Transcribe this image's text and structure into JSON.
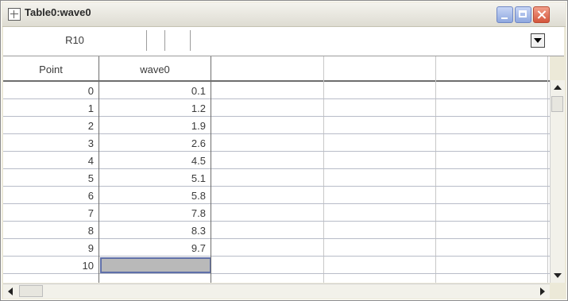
{
  "window": {
    "title": "Table0:wave0"
  },
  "entry_bar": {
    "cell_ref": "R10",
    "value": ""
  },
  "table": {
    "columns": [
      "Point",
      "wave0"
    ],
    "rows": [
      {
        "point": "0",
        "value": "0.1"
      },
      {
        "point": "1",
        "value": "1.2"
      },
      {
        "point": "2",
        "value": "1.9"
      },
      {
        "point": "3",
        "value": "2.6"
      },
      {
        "point": "4",
        "value": "4.5"
      },
      {
        "point": "5",
        "value": "5.1"
      },
      {
        "point": "6",
        "value": "5.8"
      },
      {
        "point": "7",
        "value": "7.8"
      },
      {
        "point": "8",
        "value": "8.3"
      },
      {
        "point": "9",
        "value": "9.7"
      },
      {
        "point": "10",
        "value": ""
      }
    ],
    "selected_row": "10"
  },
  "icons": {
    "window_icon": "table-window-icon",
    "minimize": "minimize-icon",
    "maximize": "maximize-icon",
    "close": "close-icon",
    "dropdown": "chevron-down-icon"
  }
}
